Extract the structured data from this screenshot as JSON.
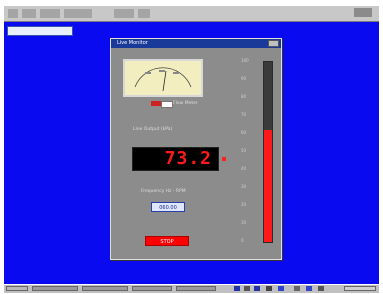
{
  "dialog": {
    "title": "Live Monitor",
    "meter_section_label": "Flow Meter",
    "display_label": "Line Output (kPa)",
    "display_value": "73.2",
    "input_label": "Frequency Hz - RPM",
    "input_value": "060.00",
    "stop_button": "STOP"
  },
  "bar_gauge": {
    "level_fraction": 0.62,
    "scale_labels": [
      "100",
      "90",
      "80",
      "70",
      "60",
      "50",
      "40",
      "30",
      "20",
      "10",
      "0"
    ]
  },
  "colors": {
    "desktop": "#0a0af0",
    "display_digits": "#ff1a1a",
    "button": "#ff0000",
    "gauge_fill": "#ff1a1a",
    "meter_face": "#f2eec0"
  },
  "icons": {
    "dialog_close": "close-icon",
    "meter_knob": "knob-icon"
  }
}
